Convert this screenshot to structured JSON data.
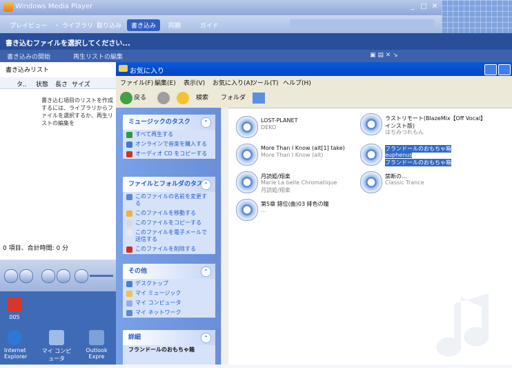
{
  "wmp": {
    "title": "Windows Media Player",
    "tabs": [
      "プレイビュー",
      "・ ライブラリ",
      "取り込み",
      "書き込み",
      "同期",
      "ガイド"
    ],
    "message": "書き込むファイルを選択してください...",
    "bar2_left": "書き込みの開始",
    "bar2_right": "再生リストの編集",
    "list_title": "書き込みリスト",
    "columns": [
      "タ..",
      "状態",
      "長さ",
      "サイズ"
    ],
    "hint": "書き込む項目のリストを作成するには、ライブラリからファイルを選択するか、再生リストの編集を",
    "footer": "0 項目、合計時間: 0 分",
    "controls": [
      "◀◀",
      "▶",
      "◀◀",
      "▶▶",
      "◀▶"
    ]
  },
  "desktop": {
    "icons": [
      {
        "label": "005"
      },
      {
        "label": "Internet Explorer"
      },
      {
        "label": "マイ コンピュータ"
      },
      {
        "label": "Outlook Expre"
      }
    ]
  },
  "explorer": {
    "title": "お気に入り",
    "menu": [
      "ファイル(F)",
      "編集(E)",
      "表示(V)",
      "お気に入り(A)",
      "ツール(T)",
      "ヘルプ(H)"
    ],
    "toolbar": {
      "back": "戻る",
      "search": "検索",
      "folders": "フォルダ"
    },
    "music_tasks": {
      "title": "ミュージックのタスク",
      "items": [
        "すべて再生する",
        "オンラインで音楽を購入する",
        "オーディオ CD をコピーする"
      ]
    },
    "file_tasks": {
      "title": "ファイルとフォルダのタスク",
      "items": [
        "このファイルの名前を変更する",
        "このファイルを移動する",
        "このファイルをコピーする",
        "このファイルを電子メールで送信する",
        "このファイルを削除する"
      ]
    },
    "other": {
      "title": "その他",
      "items": [
        "デスクトップ",
        "マイ ミュージック",
        "マイ コンピュータ",
        "マイ ネットワーク"
      ]
    },
    "details": {
      "title": "詳細",
      "value": "フランドールのおもちゃ箱"
    },
    "files": [
      {
        "title": "LOST-PLANET",
        "sub": "DEKO",
        "selected": false
      },
      {
        "title": "ラストリモート(BlazeMix【Off Vocal】インスト版)",
        "sub": "はちみつれもん",
        "selected": false
      },
      {
        "title": "More Than I Know (alt[1] take)",
        "sub": "More Than I Know (alt)",
        "selected": false
      },
      {
        "title": "フランドールのおもちゃ箱",
        "sub": "euphenus",
        "sub2": "フランドールのおもちゃ箱",
        "selected": true
      },
      {
        "title": "月読姫/翔楽",
        "sub": "Marie La belle Chromatique",
        "sub2": "月読姫/翔楽",
        "selected": false
      },
      {
        "title": "禁断の...",
        "sub": "Classic Trance",
        "selected": false
      },
      {
        "title": "第5章 錯位(曲)03 緋色の瞳",
        "sub": "...",
        "selected": false
      }
    ]
  },
  "colors": {
    "accent": "#316ac5",
    "taskpane": "#6a8fd8",
    "xp_title": "#0a5ad8"
  }
}
